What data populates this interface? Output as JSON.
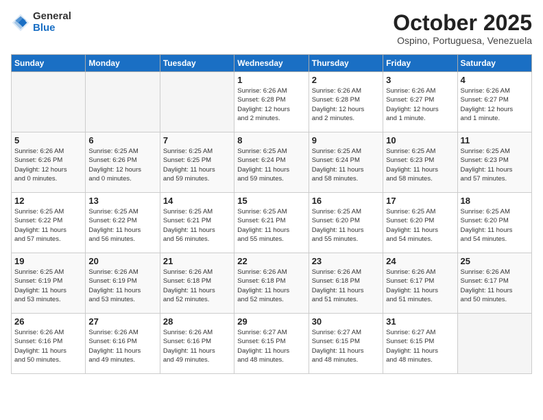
{
  "header": {
    "logo_general": "General",
    "logo_blue": "Blue",
    "month": "October 2025",
    "location": "Ospino, Portuguesa, Venezuela"
  },
  "weekdays": [
    "Sunday",
    "Monday",
    "Tuesday",
    "Wednesday",
    "Thursday",
    "Friday",
    "Saturday"
  ],
  "weeks": [
    [
      {
        "day": "",
        "info": ""
      },
      {
        "day": "",
        "info": ""
      },
      {
        "day": "",
        "info": ""
      },
      {
        "day": "1",
        "info": "Sunrise: 6:26 AM\nSunset: 6:28 PM\nDaylight: 12 hours\nand 2 minutes."
      },
      {
        "day": "2",
        "info": "Sunrise: 6:26 AM\nSunset: 6:28 PM\nDaylight: 12 hours\nand 2 minutes."
      },
      {
        "day": "3",
        "info": "Sunrise: 6:26 AM\nSunset: 6:27 PM\nDaylight: 12 hours\nand 1 minute."
      },
      {
        "day": "4",
        "info": "Sunrise: 6:26 AM\nSunset: 6:27 PM\nDaylight: 12 hours\nand 1 minute."
      }
    ],
    [
      {
        "day": "5",
        "info": "Sunrise: 6:26 AM\nSunset: 6:26 PM\nDaylight: 12 hours\nand 0 minutes."
      },
      {
        "day": "6",
        "info": "Sunrise: 6:25 AM\nSunset: 6:26 PM\nDaylight: 12 hours\nand 0 minutes."
      },
      {
        "day": "7",
        "info": "Sunrise: 6:25 AM\nSunset: 6:25 PM\nDaylight: 11 hours\nand 59 minutes."
      },
      {
        "day": "8",
        "info": "Sunrise: 6:25 AM\nSunset: 6:24 PM\nDaylight: 11 hours\nand 59 minutes."
      },
      {
        "day": "9",
        "info": "Sunrise: 6:25 AM\nSunset: 6:24 PM\nDaylight: 11 hours\nand 58 minutes."
      },
      {
        "day": "10",
        "info": "Sunrise: 6:25 AM\nSunset: 6:23 PM\nDaylight: 11 hours\nand 58 minutes."
      },
      {
        "day": "11",
        "info": "Sunrise: 6:25 AM\nSunset: 6:23 PM\nDaylight: 11 hours\nand 57 minutes."
      }
    ],
    [
      {
        "day": "12",
        "info": "Sunrise: 6:25 AM\nSunset: 6:22 PM\nDaylight: 11 hours\nand 57 minutes."
      },
      {
        "day": "13",
        "info": "Sunrise: 6:25 AM\nSunset: 6:22 PM\nDaylight: 11 hours\nand 56 minutes."
      },
      {
        "day": "14",
        "info": "Sunrise: 6:25 AM\nSunset: 6:21 PM\nDaylight: 11 hours\nand 56 minutes."
      },
      {
        "day": "15",
        "info": "Sunrise: 6:25 AM\nSunset: 6:21 PM\nDaylight: 11 hours\nand 55 minutes."
      },
      {
        "day": "16",
        "info": "Sunrise: 6:25 AM\nSunset: 6:20 PM\nDaylight: 11 hours\nand 55 minutes."
      },
      {
        "day": "17",
        "info": "Sunrise: 6:25 AM\nSunset: 6:20 PM\nDaylight: 11 hours\nand 54 minutes."
      },
      {
        "day": "18",
        "info": "Sunrise: 6:25 AM\nSunset: 6:20 PM\nDaylight: 11 hours\nand 54 minutes."
      }
    ],
    [
      {
        "day": "19",
        "info": "Sunrise: 6:25 AM\nSunset: 6:19 PM\nDaylight: 11 hours\nand 53 minutes."
      },
      {
        "day": "20",
        "info": "Sunrise: 6:26 AM\nSunset: 6:19 PM\nDaylight: 11 hours\nand 53 minutes."
      },
      {
        "day": "21",
        "info": "Sunrise: 6:26 AM\nSunset: 6:18 PM\nDaylight: 11 hours\nand 52 minutes."
      },
      {
        "day": "22",
        "info": "Sunrise: 6:26 AM\nSunset: 6:18 PM\nDaylight: 11 hours\nand 52 minutes."
      },
      {
        "day": "23",
        "info": "Sunrise: 6:26 AM\nSunset: 6:18 PM\nDaylight: 11 hours\nand 51 minutes."
      },
      {
        "day": "24",
        "info": "Sunrise: 6:26 AM\nSunset: 6:17 PM\nDaylight: 11 hours\nand 51 minutes."
      },
      {
        "day": "25",
        "info": "Sunrise: 6:26 AM\nSunset: 6:17 PM\nDaylight: 11 hours\nand 50 minutes."
      }
    ],
    [
      {
        "day": "26",
        "info": "Sunrise: 6:26 AM\nSunset: 6:16 PM\nDaylight: 11 hours\nand 50 minutes."
      },
      {
        "day": "27",
        "info": "Sunrise: 6:26 AM\nSunset: 6:16 PM\nDaylight: 11 hours\nand 49 minutes."
      },
      {
        "day": "28",
        "info": "Sunrise: 6:26 AM\nSunset: 6:16 PM\nDaylight: 11 hours\nand 49 minutes."
      },
      {
        "day": "29",
        "info": "Sunrise: 6:27 AM\nSunset: 6:15 PM\nDaylight: 11 hours\nand 48 minutes."
      },
      {
        "day": "30",
        "info": "Sunrise: 6:27 AM\nSunset: 6:15 PM\nDaylight: 11 hours\nand 48 minutes."
      },
      {
        "day": "31",
        "info": "Sunrise: 6:27 AM\nSunset: 6:15 PM\nDaylight: 11 hours\nand 48 minutes."
      },
      {
        "day": "",
        "info": ""
      }
    ]
  ]
}
